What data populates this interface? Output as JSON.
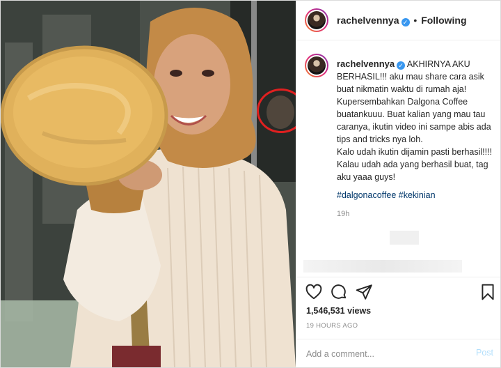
{
  "post": {
    "username": "rachelvennya",
    "verified_icon": "verified-badge-icon",
    "header_separator": "•",
    "follow_status": "Following"
  },
  "caption": {
    "username": "rachelvennya",
    "lines": [
      "AKHIRNYA AKU BERHASIL!!! aku mau share cara asik buat nikmatin waktu di rumah aja!",
      "Kupersembahkan Dalgona Coffee buatankuuu. Buat kalian yang mau tau caranya, ikutin video ini sampe abis ada tips and tricks nya loh.",
      "Kalo udah ikutin dijamin pasti berhasil!!!!",
      "Kalau udah ada yang berhasil buat, tag aku yaaa guys!"
    ],
    "hashtags": "#dalgonacoffee #kekinian",
    "time": "19h"
  },
  "stats": {
    "views": "1,546,531 views",
    "date": "19 HOURS AGO"
  },
  "actions": {
    "like_icon": "heart-icon",
    "comment_icon": "comment-bubble-icon",
    "share_icon": "paper-plane-icon",
    "save_icon": "bookmark-icon"
  },
  "comment_box": {
    "placeholder": "Add a comment...",
    "post_label": "Post"
  },
  "colors": {
    "verified": "#3897f0",
    "hashtag": "#00376b",
    "post_disabled": "#b2dffc",
    "annotation_circle": "#e02020"
  }
}
